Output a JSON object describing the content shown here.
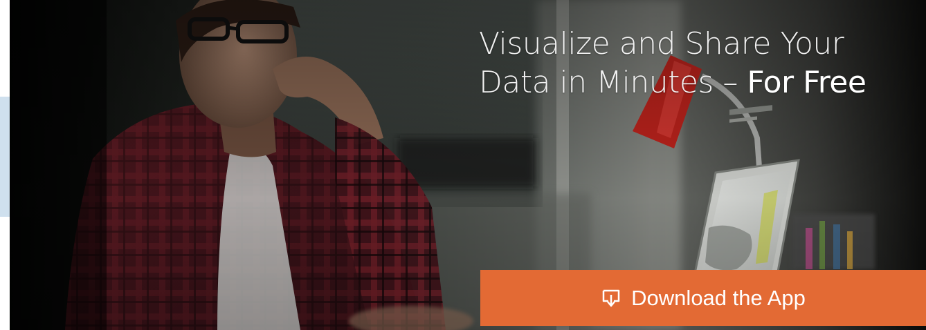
{
  "banner": {
    "headline_line1": "Visualize and Share Your",
    "headline_line2_prefix": "Data in Minutes –",
    "headline_line2_emphasis": "For Free"
  },
  "cta": {
    "label": "Download the App",
    "icon": "download-icon",
    "color": "#e36a34"
  },
  "colors": {
    "side_strip": "#cfe0ee",
    "headline_text": "#f1f1f1",
    "lamp": "#c3241d"
  }
}
